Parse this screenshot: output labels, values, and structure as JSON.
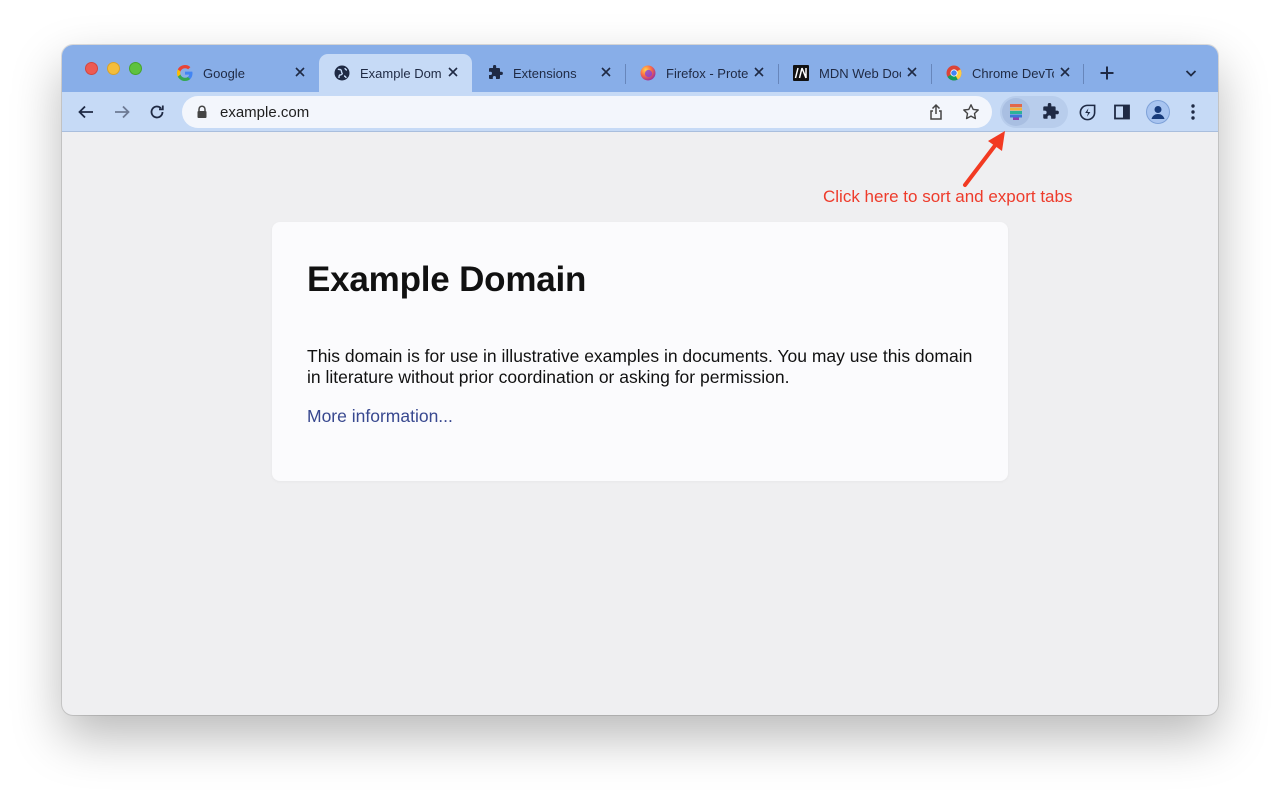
{
  "browser": {
    "tabs": [
      {
        "title": "Google",
        "icon": "google-g-icon",
        "active": false
      },
      {
        "title": "Example Domain",
        "icon": "globe-icon",
        "active": true
      },
      {
        "title": "Extensions",
        "icon": "puzzle-icon",
        "active": false
      },
      {
        "title": "Firefox - Protect your life online with privacy-first products",
        "icon": "firefox-icon",
        "active": false
      },
      {
        "title": "MDN Web Docs",
        "icon": "mdn-icon",
        "active": false
      },
      {
        "title": "Chrome DevTools",
        "icon": "chrome-icon",
        "active": false
      }
    ],
    "url": "example.com",
    "colors": {
      "tabstrip": "#88aee8",
      "toolbar": "#c6daf6",
      "content_bg": "#efeff1"
    }
  },
  "annotation": {
    "text": "Click here to sort and export tabs",
    "color": "#ee3b2b"
  },
  "page": {
    "heading": "Example Domain",
    "paragraph": "This domain is for use in illustrative examples in documents. You may use this domain in literature without prior coordination or asking for permission.",
    "link_text": "More information..."
  }
}
